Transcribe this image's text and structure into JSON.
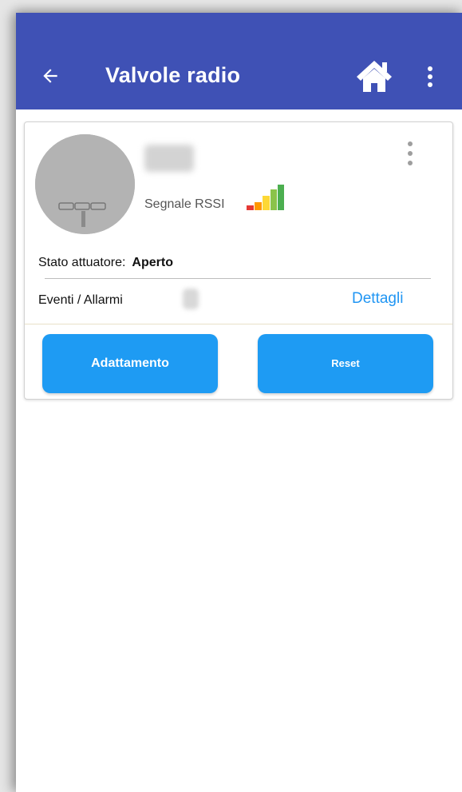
{
  "appbar": {
    "title": "Valvole radio",
    "back_icon": "arrow-left-icon",
    "home_icon": "home-icon",
    "menu_icon": "more-vertical-icon",
    "color": "#3f51b5"
  },
  "device": {
    "rssi_label": "Segnale RSSI",
    "rssi_colors": [
      "#e53935",
      "#ff9800",
      "#fdd835",
      "#8bc34a",
      "#4caf50"
    ],
    "state_label": "Stato attuatore:",
    "state_value": "Aperto",
    "events_label": "Eventi / Allarmi",
    "details_link": "Dettagli"
  },
  "actions": {
    "adapt_label": "Adattamento",
    "reset_label": "Reset",
    "color": "#1e9bf3"
  }
}
